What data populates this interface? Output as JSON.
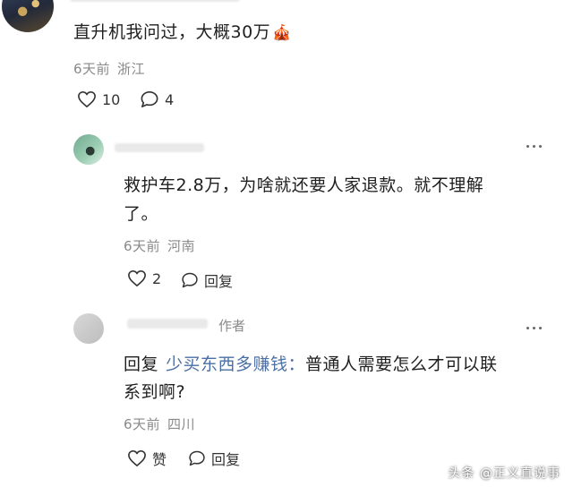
{
  "comment1": {
    "text": "直升机我问过，大概30万",
    "emoji": "🎪",
    "time": "6天前",
    "location": "浙江",
    "likes": "10",
    "replies": "4"
  },
  "comment2": {
    "line1": "救护车2.8万，为啥就还要人家退款。就不理解",
    "line2": "了。",
    "time": "6天前",
    "location": "河南",
    "likes": "2",
    "reply_label": "回复"
  },
  "comment3": {
    "author_badge": "作者",
    "reply_prefix": "回复",
    "reply_target": "少买东西多赚钱：",
    "line1_rest": "普通人需要怎么才可以联",
    "line2": "系到啊?",
    "time": "6天前",
    "location": "四川",
    "like_label": "赞",
    "reply_label": "回复"
  },
  "watermark": "头条 @正义直说事"
}
